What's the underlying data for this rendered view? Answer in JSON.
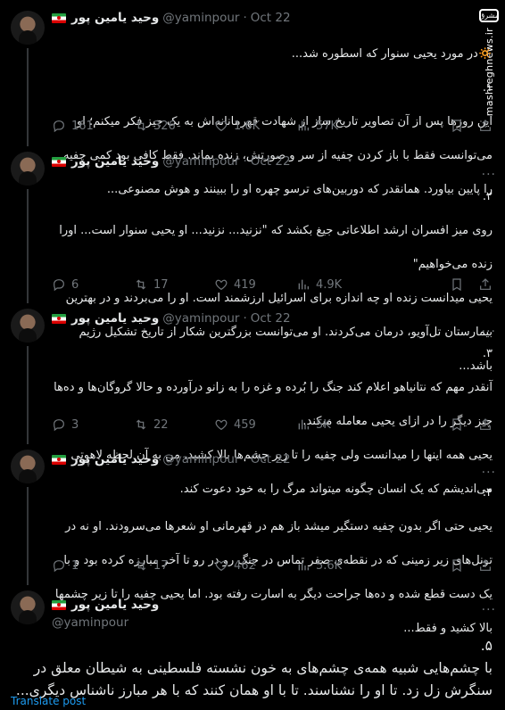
{
  "watermark": {
    "text": "mashreghnews.ir",
    "logo": "مشرق"
  },
  "tweets": [
    {
      "name": "وحید یامین پور",
      "handle": "@yaminpour",
      "date": "Oct 22",
      "lines": [
        "🔅در مورد یحیی سنوار که اسطوره شد...",
        "۱.",
        "این روزها پس از آن تصاویر تاریخ ساز از شهادت قهرمانانه‌اش به یک چیز فکر میکنم؛ او",
        "می‌توانست فقط با باز کردن چفیه از سر و صورتش، زنده بماند. فقط کافی بود کمی چفیه",
        "را پایین بیاورد. همانقدر که دوربین‌های ترسو چهره او را ببینند و هوش مصنوعی..."
      ],
      "replies": "161",
      "reposts": "326",
      "likes": "1.6K",
      "views": "57K"
    },
    {
      "name": "وحید یامین پور",
      "handle": "@yaminpour",
      "date": "Oct 22",
      "lines": [
        "۲.",
        "روی میز افسران ارشد اطلاعاتی جیغ بکشد که \"نزنید... نزنید... او یحیی سنوار است... اورا",
        "زنده می‌خواهیم\"",
        "یحیی میدانست زنده او چه اندازه برای اسرائیل ارزشمند است. او را می‌بردند و در بهترین",
        "بیمارستان تل‌آویو، درمان می‌کردند. او می‌توانست بزرگترین شکار از تاریخ تشکیل رژیم",
        "باشد..."
      ],
      "replies": "6",
      "reposts": "17",
      "likes": "419",
      "views": "4.9K"
    },
    {
      "name": "وحید یامین پور",
      "handle": "@yaminpour",
      "date": "Oct 22",
      "lines": [
        "۳.",
        "آنقدر مهم که نتانیاهو اعلام کند جنگ را بُرده و غزه را به زانو درآورده و حالا گروگان‌ها و ده‌ها",
        "چیز دیگر را در ازای یحیی معامله میکند.",
        "یحیی همه اینها را میدانست ولی چفیه را تا زیر چشم‌ها بالا کشید. من به آن لحظه لاهوتی",
        "می‌اندیشم که یک انسان چگونه میتواند مرگ را به خود دعوت کند."
      ],
      "replies": "3",
      "reposts": "22",
      "likes": "459",
      "views": "5K"
    },
    {
      "name": "وحید یامین پور",
      "handle": "@yaminpour",
      "date": "Oct 22",
      "lines": [
        "۴.",
        "یحیی حتی اگر بدون چفیه دستگیر میشد باز هم در قهرمانی او شعرها می‌سرودند. او نه در",
        "تونل‌های زیر زمینی که در نقطه‌ی صفر تماس در جنگ رو در رو تا آخر مبارزه کرده بود و با",
        "یک دست قطع شده و ده‌ها جراحت دیگر به اسارت رفته بود. اما یحیی چفیه را تا زیر چشمها",
        "بالا کشید و فقط..."
      ],
      "replies": "1",
      "reposts": "17",
      "likes": "462",
      "views": "5.6K"
    }
  ],
  "last": {
    "name": "وحید یامین پور",
    "handle": "@yaminpour",
    "lines": [
      "۵.",
      "با چشم‌هایی شبیه همه‌ی چشم‌های به خون نشسته فلسطینی به شیطان معلق در",
      "سنگرش زل زد. تا او را نشناسند. تا با او همان کنند که با هر مبارز ناشناس دیگری..."
    ],
    "translate": "Translate post"
  },
  "colors": {
    "bg": "#000000",
    "text": "#e7e9ea",
    "muted": "#71767b",
    "link": "#1d9bf0",
    "divider": "#2f3336"
  }
}
